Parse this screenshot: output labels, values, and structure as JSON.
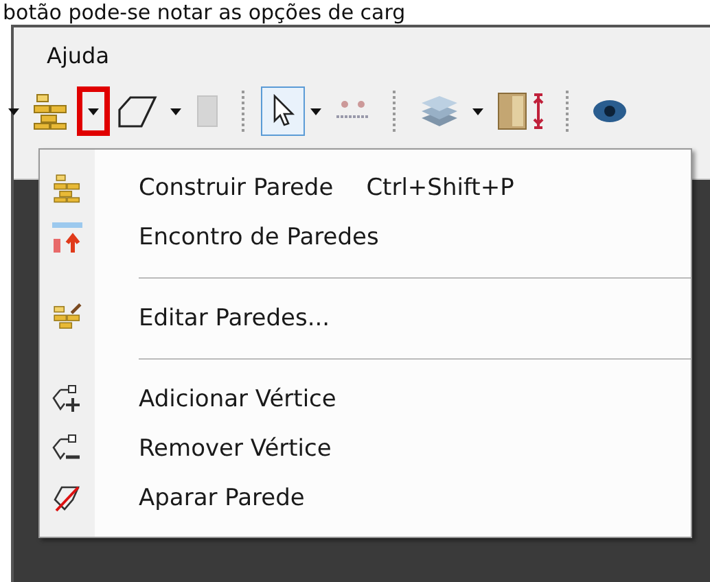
{
  "caption": "botão pode-se notar as opções de carg",
  "menu_bar": [
    {
      "label": "Ajuda"
    }
  ],
  "toolbar": [
    {
      "kind": "dropdown",
      "highlighted": false
    },
    {
      "kind": "button",
      "selected": false
    },
    {
      "kind": "dropdown",
      "highlighted": true
    },
    {
      "kind": "button",
      "selected": false
    },
    {
      "kind": "dropdown",
      "highlighted": false
    },
    {
      "kind": "button",
      "selected": false
    },
    {
      "kind": "separator"
    },
    {
      "kind": "button",
      "selected": true
    },
    {
      "kind": "dropdown",
      "highlighted": false
    },
    {
      "kind": "button",
      "selected": false
    },
    {
      "kind": "separator"
    },
    {
      "kind": "button",
      "selected": false
    },
    {
      "kind": "dropdown",
      "highlighted": false
    },
    {
      "kind": "button",
      "selected": false
    },
    {
      "kind": "separator"
    },
    {
      "kind": "button",
      "selected": false
    }
  ],
  "menu": [
    {
      "kind": "item",
      "label": "Construir Parede",
      "shortcut": "Ctrl+Shift+P"
    },
    {
      "kind": "item",
      "label": "Encontro de Paredes"
    },
    {
      "kind": "separator"
    },
    {
      "kind": "item",
      "label": "Editar Paredes..."
    },
    {
      "kind": "separator"
    },
    {
      "kind": "item",
      "label": "Adicionar Vértice"
    },
    {
      "kind": "item",
      "label": "Remover Vértice"
    },
    {
      "kind": "item",
      "label": "Aparar Parede"
    }
  ]
}
